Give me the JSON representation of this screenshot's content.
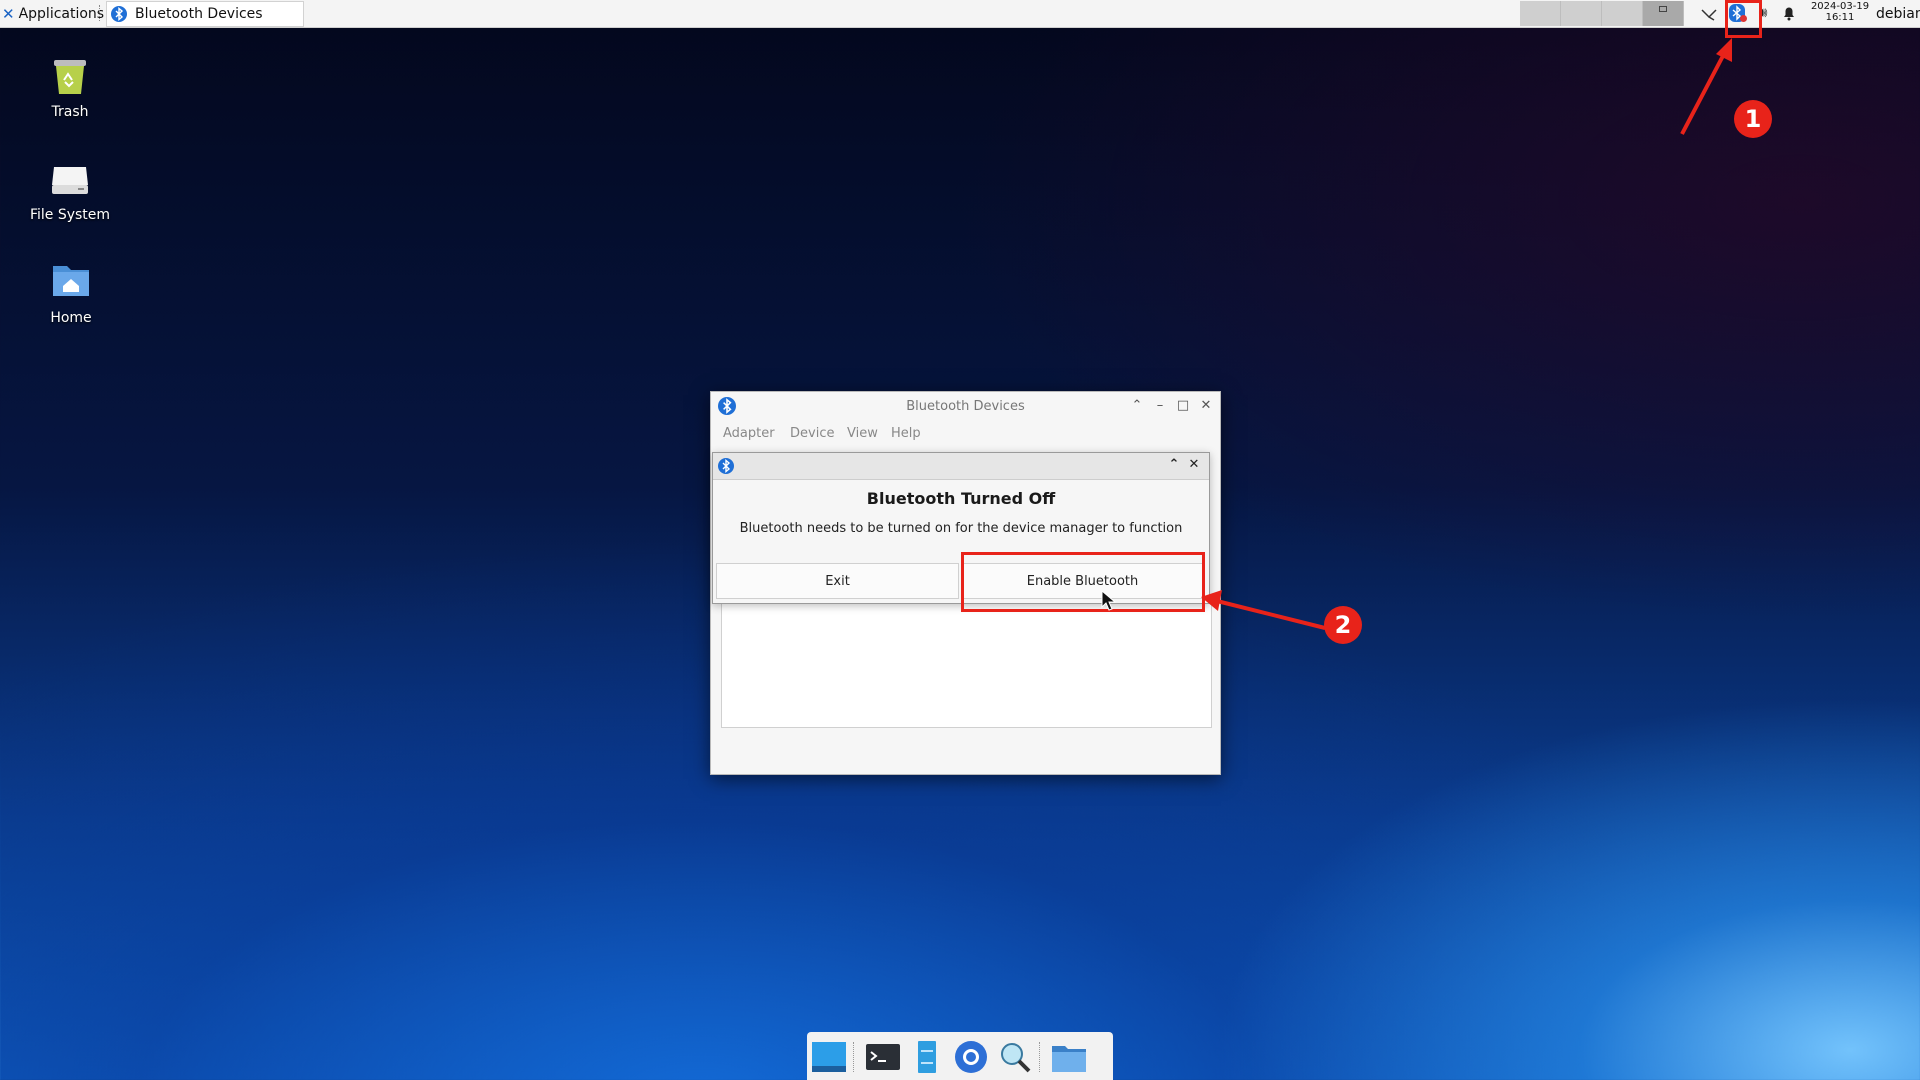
{
  "top_panel": {
    "applications_label": "Applications",
    "task_title": "Bluetooth Devices",
    "clock_date": "2024-03-19",
    "clock_time": "16:11",
    "username": "debian",
    "tray_icons": [
      "network-icon",
      "bluetooth-icon",
      "volume-icon",
      "notification-bell-icon"
    ]
  },
  "desktop_icons": [
    {
      "label": "Trash",
      "icon": "trash-icon"
    },
    {
      "label": "File System",
      "icon": "drive-icon"
    },
    {
      "label": "Home",
      "icon": "home-folder-icon"
    }
  ],
  "window": {
    "title": "Bluetooth Devices",
    "menu": [
      "Adapter",
      "Device",
      "View",
      "Help"
    ]
  },
  "dialog": {
    "title": "Bluetooth Turned Off",
    "message": "Bluetooth needs to be turned on for the device manager to function",
    "exit_label": "Exit",
    "enable_label": "Enable Bluetooth"
  },
  "annotations": {
    "step1": "1",
    "step2": "2",
    "color": "#e8231a"
  },
  "dock": [
    "show-desktop-icon",
    "terminal-icon",
    "file-manager-icon",
    "browser-icon",
    "app-finder-icon",
    "folder-icon"
  ]
}
